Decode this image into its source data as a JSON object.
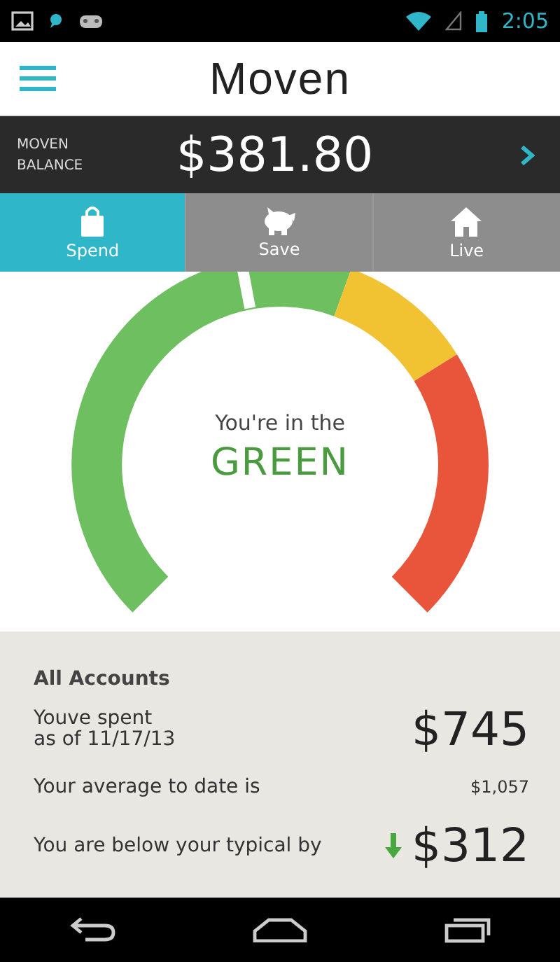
{
  "status_bar": {
    "time": "2:05"
  },
  "header": {
    "title": "Moven"
  },
  "balance": {
    "label": "MOVEN BALANCE",
    "amount": "$381.80"
  },
  "tabs": [
    {
      "label": "Spend",
      "kind": "bag",
      "selected": true
    },
    {
      "label": "Save",
      "kind": "piggy",
      "selected": false
    },
    {
      "label": "Live",
      "kind": "house",
      "selected": false
    }
  ],
  "gauge": {
    "caption": "You're in the",
    "status": "GREEN",
    "level": 0.46
  },
  "summary": {
    "title": "All Accounts",
    "spent_label": "Youve spent",
    "spent_date": "as of 11/17/13",
    "spent_amount": "$745",
    "average_label": "Your average to date is",
    "average_amount": "$1,057",
    "difference": {
      "label": "You are below your typical by",
      "amount": "$312",
      "kind": "down"
    }
  }
}
